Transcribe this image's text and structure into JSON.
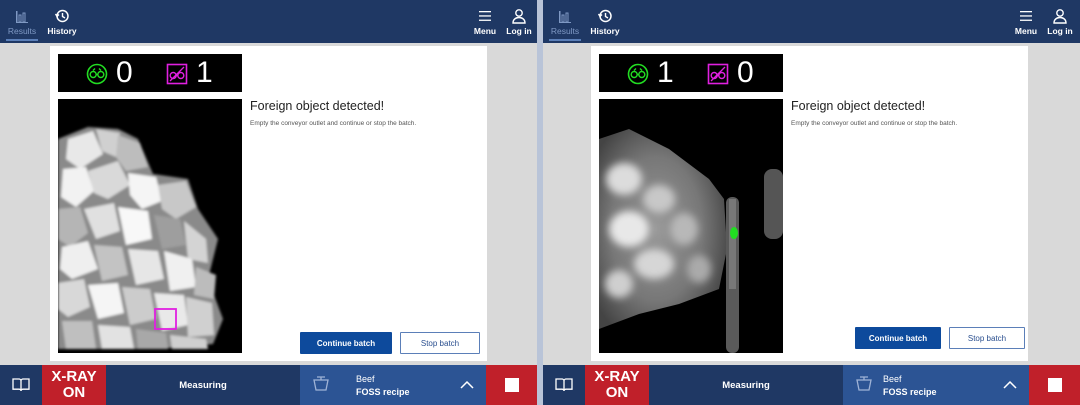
{
  "screens": [
    {
      "nav": {
        "results": "Results",
        "history": "History",
        "menu": "Menu",
        "login": "Log in"
      },
      "counters": {
        "ok": "0",
        "rejected": "1"
      },
      "message": {
        "title": "Foreign object detected!",
        "body": "Empty the conveyor outlet and continue or stop the batch."
      },
      "buttons": {
        "continue": "Continue batch",
        "stop": "Stop batch"
      },
      "bottom": {
        "xray_line1": "X-RAY",
        "xray_line2": "ON",
        "status": "Measuring",
        "product": "Beef",
        "recipe": "FOSS recipe"
      }
    },
    {
      "nav": {
        "results": "Results",
        "history": "History",
        "menu": "Menu",
        "login": "Log in"
      },
      "counters": {
        "ok": "1",
        "rejected": "0"
      },
      "message": {
        "title": "Foreign object detected!",
        "body": "Empty the conveyor outlet and continue or stop the batch."
      },
      "buttons": {
        "continue": "Continue batch",
        "stop": "Stop batch"
      },
      "bottom": {
        "xray_line1": "X-RAY",
        "xray_line2": "ON",
        "status": "Measuring",
        "product": "Beef",
        "recipe": "FOSS recipe"
      }
    }
  ],
  "colors": {
    "topbar": "#1f3864",
    "primary": "#0d4a9c",
    "alert": "#c0202a",
    "ok_icon": "#22dd22",
    "reject_icon": "#e020e0"
  },
  "icons": [
    "results-icon",
    "history-icon",
    "menu-icon",
    "login-icon",
    "ok-count-icon",
    "reject-count-icon",
    "book-icon",
    "scale-icon",
    "chevron-up-icon",
    "stop-square-icon"
  ]
}
